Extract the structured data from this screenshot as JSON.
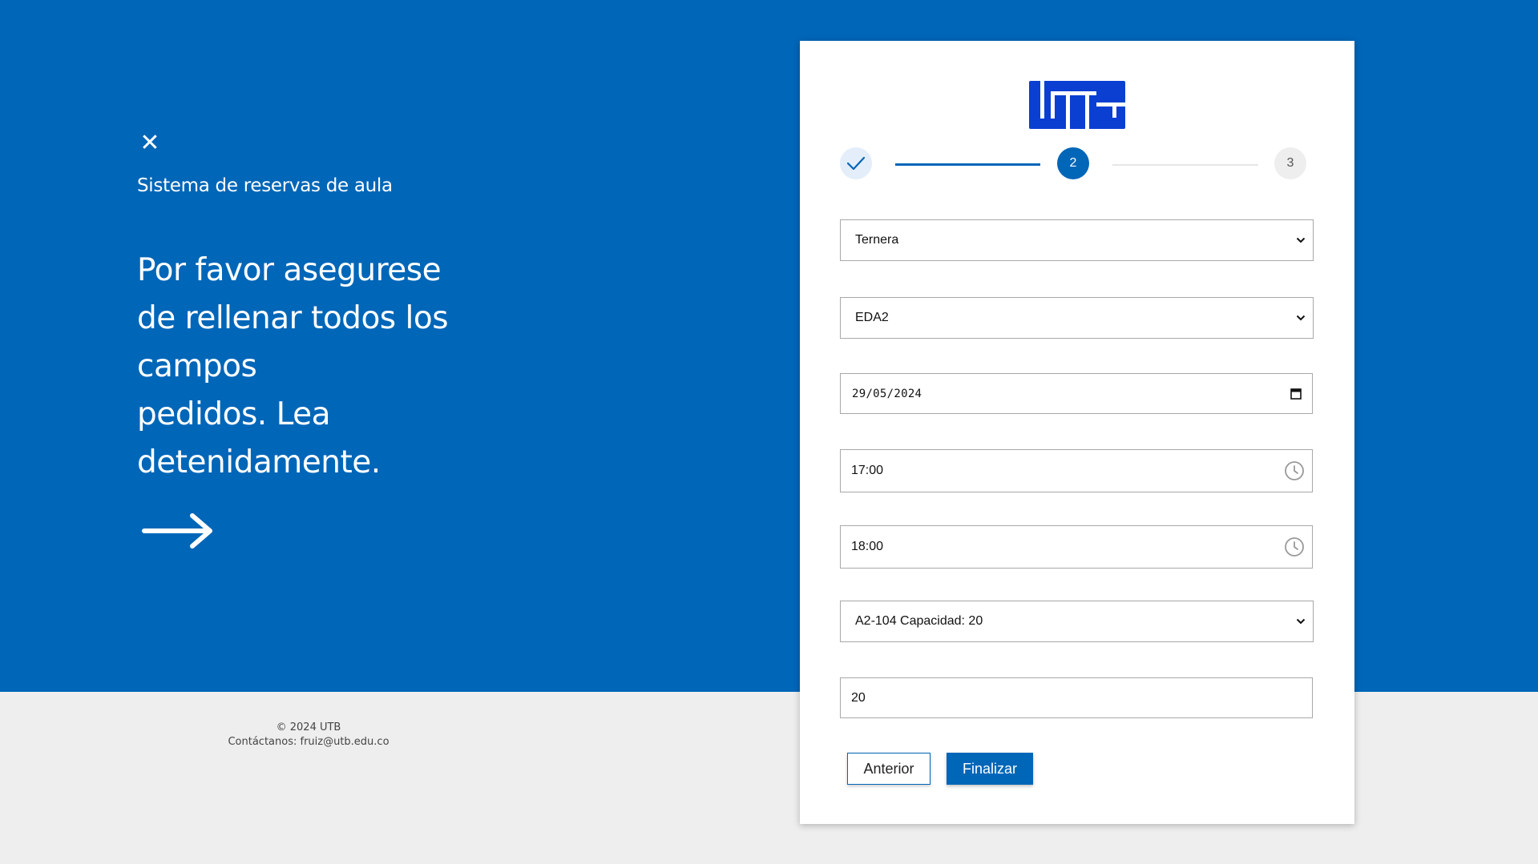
{
  "left_panel": {
    "app_title": "Sistema de reservas de aula",
    "headline_lines": [
      "Por favor asegurese",
      "de rellenar todos los",
      "campos",
      "pedidos. Lea",
      "detenidamente."
    ]
  },
  "footer": {
    "copyright": "© 2024 UTB",
    "contact": "Contáctanos: fruiz@utb.edu.co"
  },
  "stepper": {
    "step2_label": "2",
    "step3_label": "3",
    "current_step": 2
  },
  "form": {
    "select_1": "Ternera",
    "select_2": "EDA2",
    "date": "29/05/2024",
    "start_time": "17:00",
    "end_time": "18:00",
    "classroom": "A2-104 Capacidad: 20",
    "quantity": "20"
  },
  "buttons": {
    "previous": "Anterior",
    "finish": "Finalizar"
  },
  "colors": {
    "primary": "#0066b8",
    "logo": "#0a3fd1",
    "background": "#eeeeee"
  },
  "icons": [
    "close-icon",
    "arrow-right-icon",
    "check-icon",
    "chevron-down-icon",
    "calendar-icon",
    "clock-icon"
  ]
}
